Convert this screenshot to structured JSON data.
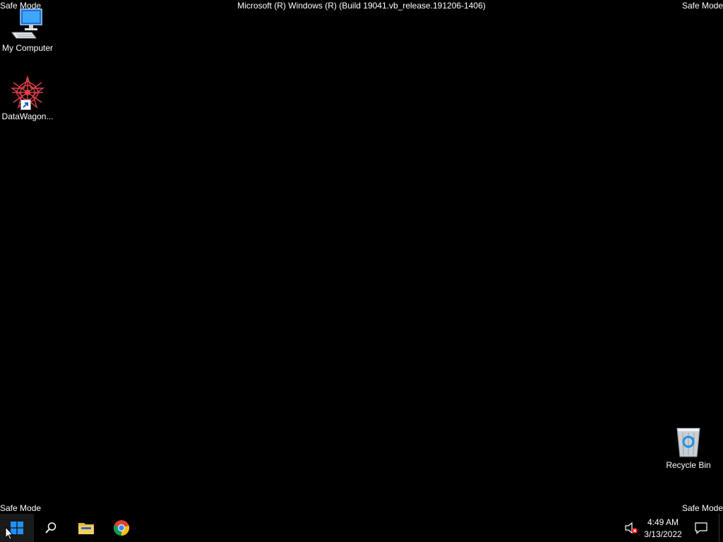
{
  "watermarks": {
    "safe_mode": "Safe Mode",
    "build": "Microsoft (R) Windows (R) (Build 19041.vb_release.191206-1406)"
  },
  "desktop_icons": {
    "my_computer": "My Computer",
    "datawagon": "DataWagon...",
    "recycle_bin": "Recycle Bin"
  },
  "taskbar": {
    "pinned": [
      "start-icon",
      "search-icon",
      "file-explorer-icon",
      "chrome-icon"
    ],
    "clock": {
      "time": "4:49 AM",
      "date": "3/13/2022"
    },
    "volume_state": "muted"
  },
  "colors": {
    "background": "#000000",
    "start_blue": "#1e90ff",
    "folder_yellow": "#e9b741"
  }
}
